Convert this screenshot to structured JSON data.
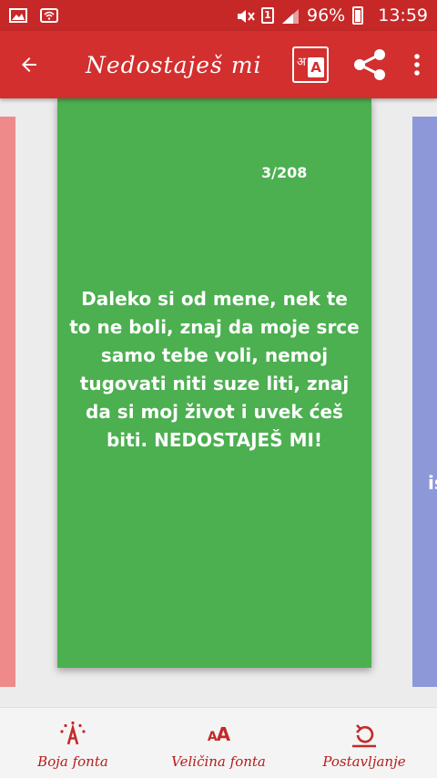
{
  "status_bar": {
    "battery": "96%",
    "time": "13:59",
    "sim": "1"
  },
  "app_bar": {
    "title": "Nedostaješ mi",
    "translate_glyph_left": "अ",
    "translate_glyph_right": "A"
  },
  "card": {
    "counter": "3/208",
    "quote": "Daleko si od mene, nek te to ne boli, znaj da moje srce samo tebe voli, nemoj tugovati niti suze liti, znaj da si moj život i uvek ćeš biti. NEDOSTAJEŠ MI!",
    "right_peek": "is",
    "color": "#4caf50",
    "left_card_color": "#ef8a8a",
    "right_card_color": "#8c98d8"
  },
  "bottom_bar": {
    "items": [
      {
        "label": "Boja fonta",
        "icon": "font-color-icon"
      },
      {
        "label": "Veličina fonta",
        "icon": "font-size-icon",
        "glyph_big": "A",
        "glyph_small": "A"
      },
      {
        "label": "Postavljanje",
        "icon": "set-wallpaper-icon"
      }
    ]
  },
  "colors": {
    "accent": "#d32f2f",
    "status": "#c62828"
  }
}
